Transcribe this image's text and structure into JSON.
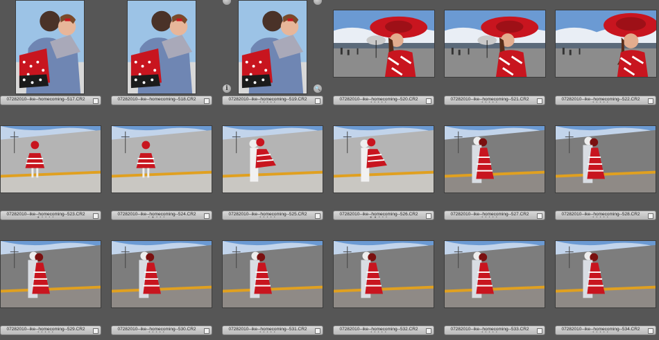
{
  "grid": {
    "rows": [
      [
        {
          "filename": "07282010--ike--homecoming--517.CR2",
          "dots": "",
          "scene": "hug-portrait"
        },
        {
          "filename": "07282010--ike--homecoming--518.CR2",
          "dots": "",
          "scene": "hug-portrait"
        },
        {
          "filename": "07282010--ike--homecoming--519.CR2",
          "dots": "• • • • •",
          "scene": "hug-portrait"
        },
        {
          "filename": "07282010--ike--homecoming--520.CR2",
          "dots": "• • • • •",
          "scene": "hat-woman"
        },
        {
          "filename": "07282010--ike--homecoming--521.CR2",
          "dots": "• • • • •",
          "scene": "hat-woman"
        },
        {
          "filename": "07282010--ike--homecoming--522.CR2",
          "dots": "• • • • •",
          "scene": "hat-woman-close"
        }
      ],
      [
        {
          "filename": "07282010--ike--homecoming--523.CR2",
          "dots": "● • • • •",
          "scene": "pier-run"
        },
        {
          "filename": "07282010--ike--homecoming--524.CR2",
          "dots": "• ● • • •",
          "scene": "pier-run"
        },
        {
          "filename": "07282010--ike--homecoming--525.CR2",
          "dots": "• • • • •",
          "scene": "pier-hug"
        },
        {
          "filename": "07282010--ike--homecoming--526.CR2",
          "dots": "● ● • • •",
          "scene": "pier-hug"
        },
        {
          "filename": "07282010--ike--homecoming--527.CR2",
          "dots": "• • • • •",
          "scene": "pier-embrace"
        },
        {
          "filename": "07282010--ike--homecoming--528.CR2",
          "dots": "• • • • •",
          "scene": "pier-embrace"
        }
      ],
      [
        {
          "filename": "07282010--ike--homecoming--529.CR2",
          "dots": "• • • • •",
          "scene": "pier-embrace"
        },
        {
          "filename": "07282010--ike--homecoming--530.CR2",
          "dots": "• • • • •",
          "scene": "pier-embrace"
        },
        {
          "filename": "07282010--ike--homecoming--531.CR2",
          "dots": "• • • • •",
          "scene": "pier-embrace"
        },
        {
          "filename": "07282010--ike--homecoming--532.CR2",
          "dots": "• • • • •",
          "scene": "pier-embrace"
        },
        {
          "filename": "07282010--ike--homecoming--533.CR2",
          "dots": "• • • • •",
          "scene": "pier-embrace"
        },
        {
          "filename": "07282010--ike--homecoming--534.CR2",
          "dots": "• • • • •",
          "scene": "pier-embrace"
        }
      ]
    ]
  },
  "overlay_buttons": {
    "info_glyph": "i",
    "zoom_glyph": "🔍"
  },
  "colors": {
    "background": "#565656",
    "label_bar": "#c8c8c8",
    "dress_red": "#c8151f",
    "sky": "#6b9ad3"
  }
}
